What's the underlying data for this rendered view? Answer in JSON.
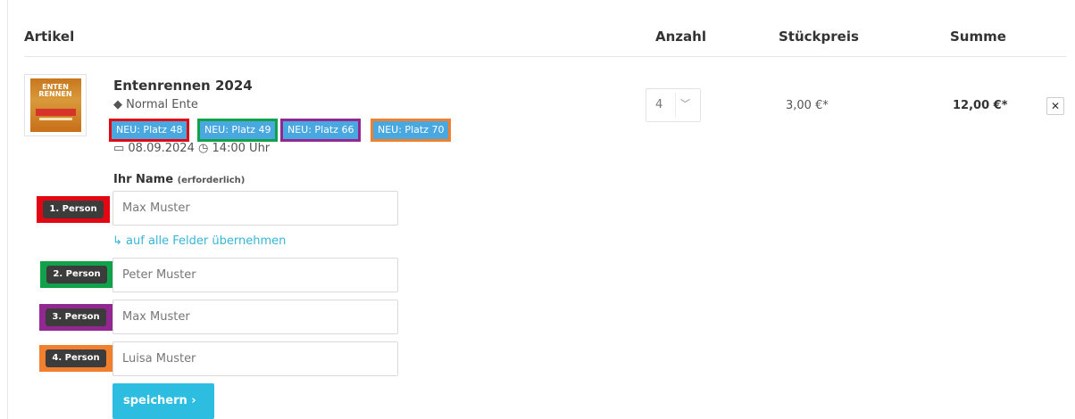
{
  "table_header": {
    "article": "Artikel",
    "quantity": "Anzahl",
    "unit_price": "Stückpreis",
    "sum": "Summe"
  },
  "thumbnail": {
    "line1": "ENTEN",
    "line2": "RENNEN"
  },
  "item": {
    "name": "Entenrennen 2024",
    "variant_icon": "tag-icon",
    "variant": "◆ Normal Ente",
    "badges": [
      {
        "label": "NEU: Platz 48",
        "outline": "#e30613"
      },
      {
        "label": "NEU: Platz 49",
        "outline": "#12a14b"
      },
      {
        "label": "NEU: Platz 66",
        "outline": "#92278f"
      },
      {
        "label": "NEU: Platz 70",
        "outline": "#f07f2e"
      }
    ],
    "date": "08.09.2024",
    "time": "14:00 Uhr",
    "datetime_text": "▭ 08.09.2024  ◷ 14:00 Uhr",
    "quantity": "4",
    "unit_price": "3,00 €*",
    "total": "12,00 €*",
    "remove_label": "✕"
  },
  "name_section": {
    "label": "Ihr Name",
    "required": "(erforderlich)",
    "apply_all": "↳ auf alle Felder übernehmen",
    "persons": [
      {
        "tag": "1. Person",
        "outline": "#e30613",
        "value": "Max Muster"
      },
      {
        "tag": "2. Person",
        "outline": "#12a14b",
        "value": "Peter Muster"
      },
      {
        "tag": "3. Person",
        "outline": "#92278f",
        "value": "Max Muster"
      },
      {
        "tag": "4. Person",
        "outline": "#f07f2e",
        "value": "Luisa Muster"
      }
    ],
    "save": "speichern  ›"
  },
  "colors": {
    "badge_blue": "#4aa8e0",
    "link_cyan": "#35b5d6",
    "button_cyan": "#2cbde0"
  }
}
